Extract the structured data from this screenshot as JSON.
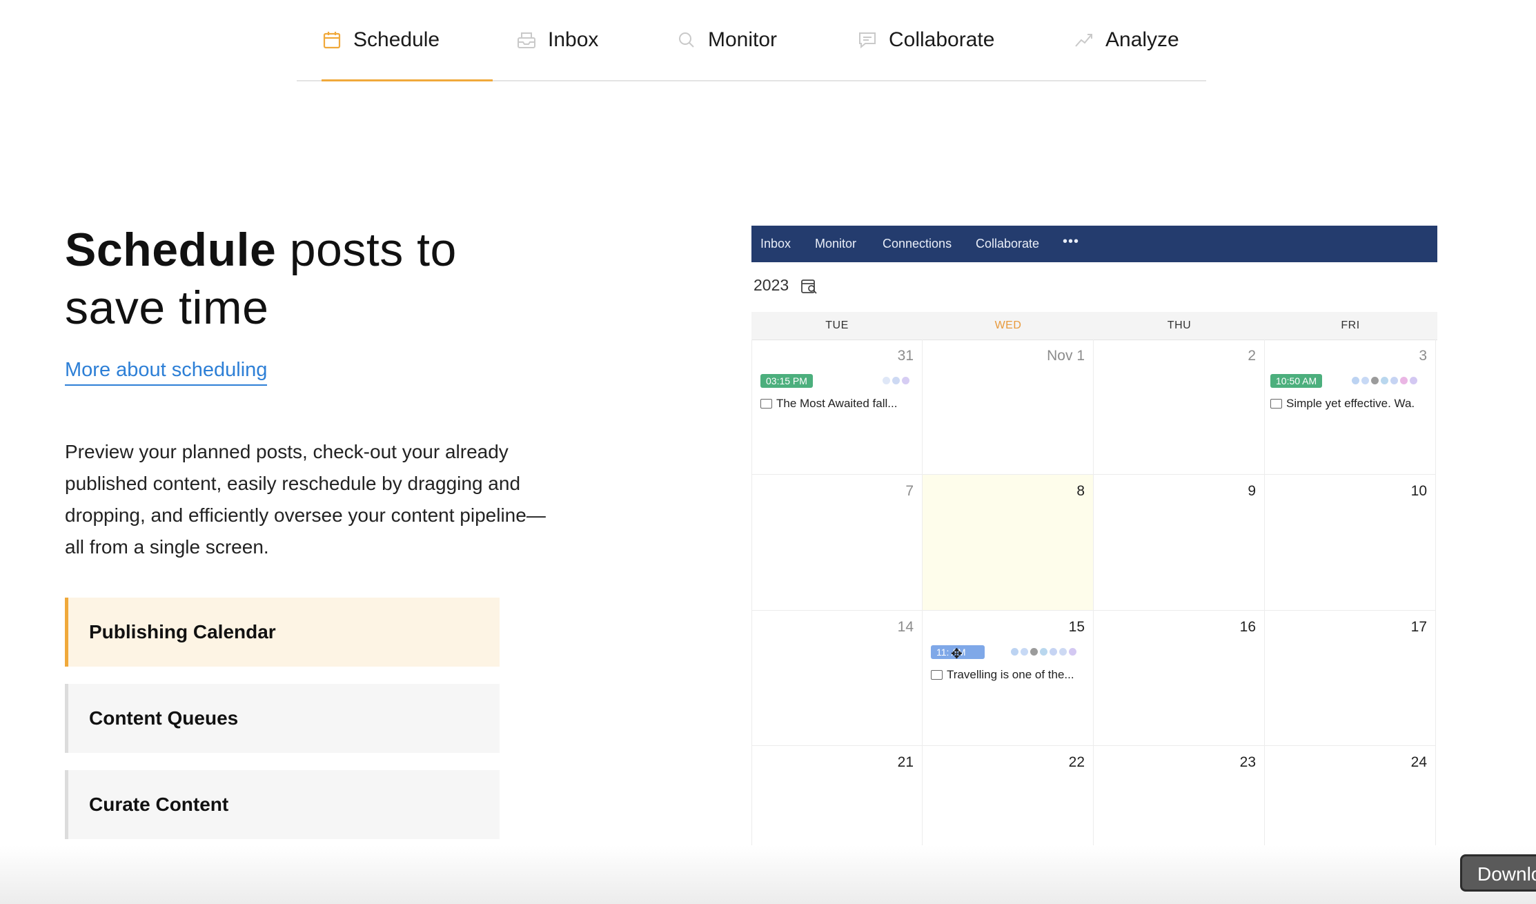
{
  "nav": {
    "tabs": [
      {
        "label": "Schedule",
        "icon": "calendar-icon",
        "active": true
      },
      {
        "label": "Inbox",
        "icon": "inbox-icon",
        "active": false
      },
      {
        "label": "Monitor",
        "icon": "search-icon",
        "active": false
      },
      {
        "label": "Collaborate",
        "icon": "chat-icon",
        "active": false
      },
      {
        "label": "Analyze",
        "icon": "trend-icon",
        "active": false
      }
    ],
    "accent_color": "#f0a93b"
  },
  "hero": {
    "title_bold": "Schedule",
    "title_rest": " posts to save time",
    "link_text": "More about scheduling",
    "description": "Preview your planned posts, check-out your already published content, easily reschedule by dragging and dropping, and efficiently oversee your content pipeline—all from a single screen."
  },
  "features": [
    {
      "label": "Publishing Calendar",
      "active": true
    },
    {
      "label": "Content Queues",
      "active": false
    },
    {
      "label": "Curate Content",
      "active": false
    }
  ],
  "calendar": {
    "appbar_items": [
      "Inbox",
      "Monitor",
      "Connections",
      "Collaborate",
      "•••"
    ],
    "appbar_color": "#243c6e",
    "year": "2023",
    "days": [
      "TUE",
      "WED",
      "THU",
      "FRI"
    ],
    "highlight_day_color": "#e89a3c",
    "weeks": [
      [
        "31",
        "Nov 1",
        "2",
        "3"
      ],
      [
        "7",
        "8",
        "9",
        "10"
      ],
      [
        "14",
        "15",
        "16",
        "17"
      ],
      [
        "21",
        "22",
        "23",
        "24"
      ]
    ],
    "posts": [
      {
        "time": "03:15 PM",
        "title": "The Most Awaited fall...",
        "badge_color": "#4caf7d"
      },
      {
        "time": "10:50 AM",
        "title": "Simple yet effective. Wa.",
        "badge_color": "#4caf7d"
      },
      {
        "time": "11:  AM",
        "title": "Travelling is one of the...",
        "badge_color": "#7fa8e8"
      }
    ]
  },
  "tooltip": {
    "text": "Download"
  }
}
